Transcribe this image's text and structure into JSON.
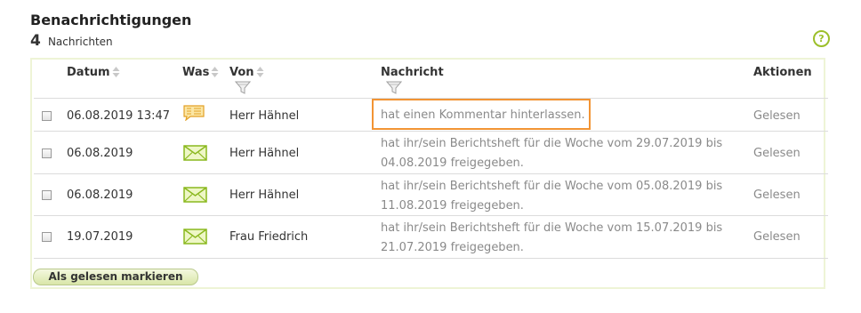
{
  "header": {
    "title": "Benachrichtigungen",
    "count": "4",
    "count_label": "Nachrichten",
    "help_label": "?"
  },
  "table": {
    "columns": {
      "datum": "Datum",
      "was": "Was",
      "von": "Von",
      "nachricht": "Nachricht",
      "aktionen": "Aktionen"
    },
    "rows": [
      {
        "datum": "06.08.2019 13:47",
        "was": "comment-icon",
        "von": "Herr Hähnel",
        "line1": "hat einen Kommentar hinterlassen.",
        "line2": "",
        "action": "Gelesen"
      },
      {
        "datum": "06.08.2019",
        "was": "envelope-icon",
        "von": "Herr Hähnel",
        "line1": "hat ihr/sein Berichtsheft für die Woche vom 29.07.2019 bis",
        "line2": "04.08.2019 freigegeben.",
        "action": "Gelesen"
      },
      {
        "datum": "06.08.2019",
        "was": "envelope-icon",
        "von": "Herr Hähnel",
        "line1": "hat ihr/sein Berichtsheft für die Woche vom 05.08.2019 bis",
        "line2": "11.08.2019 freigegeben.",
        "action": "Gelesen"
      },
      {
        "datum": "19.07.2019",
        "was": "envelope-icon",
        "von": "Frau Friedrich",
        "line1": "hat ihr/sein Berichtsheft für die Woche vom 15.07.2019 bis",
        "line2": "21.07.2019 freigegeben.",
        "action": "Gelesen"
      }
    ]
  },
  "footer": {
    "mark_read_label": "Als gelesen markieren"
  },
  "colors": {
    "accent": "#9cbf2a",
    "highlight": "#f29434"
  }
}
